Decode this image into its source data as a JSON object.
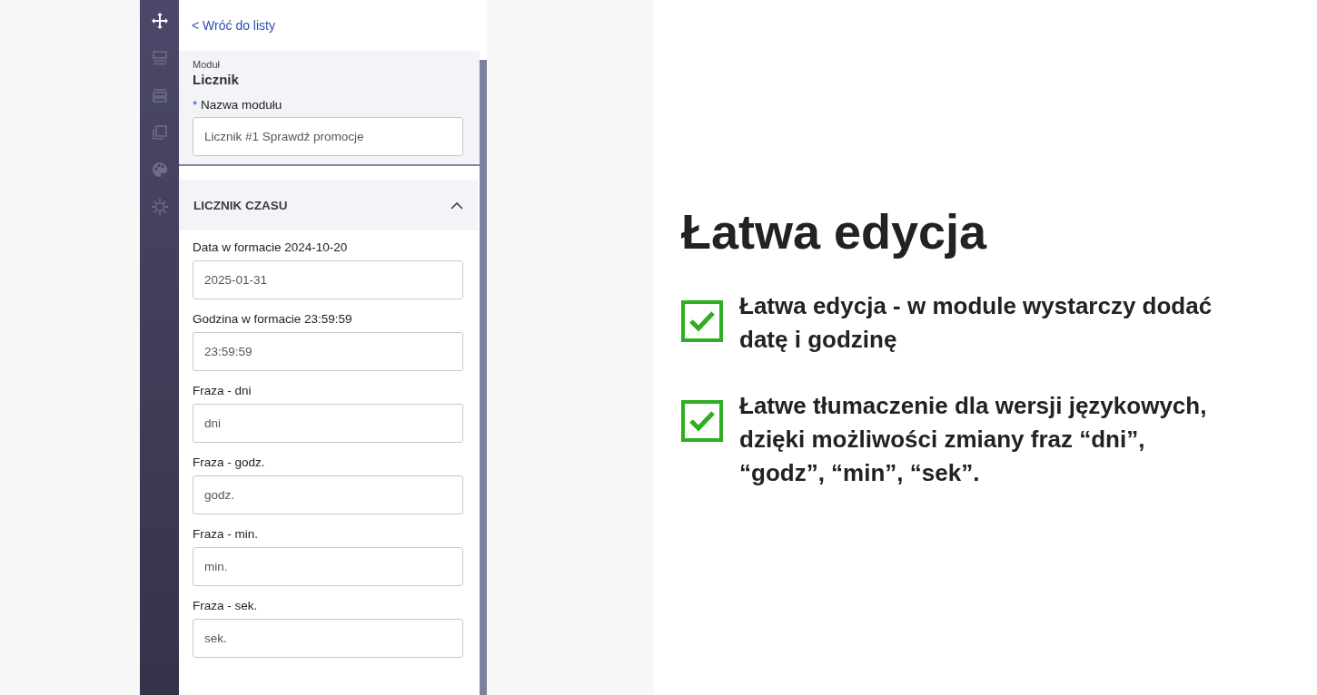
{
  "sidebar": {
    "items": [
      {
        "kind": "move",
        "selected": true
      },
      {
        "kind": "layout",
        "selected": false
      },
      {
        "kind": "rows",
        "selected": false
      },
      {
        "kind": "copy",
        "selected": false
      },
      {
        "kind": "palette",
        "selected": false
      },
      {
        "kind": "settings",
        "selected": false
      }
    ]
  },
  "back_link": {
    "icon": "<",
    "label": "Wróć do listy"
  },
  "module": {
    "caption": "Moduł",
    "name": "Licznik",
    "name_field": {
      "required_mark": "*",
      "label": "Nazwa modułu",
      "value": "Licznik #1 Sprawdź promocje"
    }
  },
  "section": {
    "title": "LICZNIK CZASU",
    "expanded": true,
    "fields": [
      {
        "label": "Data w formacie 2024-10-20",
        "value": "2025-01-31"
      },
      {
        "label": "Godzina w formacie 23:59:59",
        "value": "23:59:59"
      },
      {
        "label": "Fraza - dni",
        "value": "dni"
      },
      {
        "label": "Fraza - godz.",
        "value": "godz."
      },
      {
        "label": "Fraza - min.",
        "value": "min."
      },
      {
        "label": "Fraza - sek.",
        "value": "sek."
      }
    ]
  },
  "promo": {
    "heading": "Łatwa edycja",
    "points": [
      {
        "checked": true,
        "lines": [
          "Łatwa edycja - w module wystarczy dodać",
          "datę i godzinę"
        ]
      },
      {
        "checked": true,
        "lines": [
          "Łatwe tłumaczenie dla wersji językowych,",
          "dzięki możliwości zmiany fraz “dni”,",
          "“godz”, “min”, “sek”."
        ]
      }
    ]
  }
}
